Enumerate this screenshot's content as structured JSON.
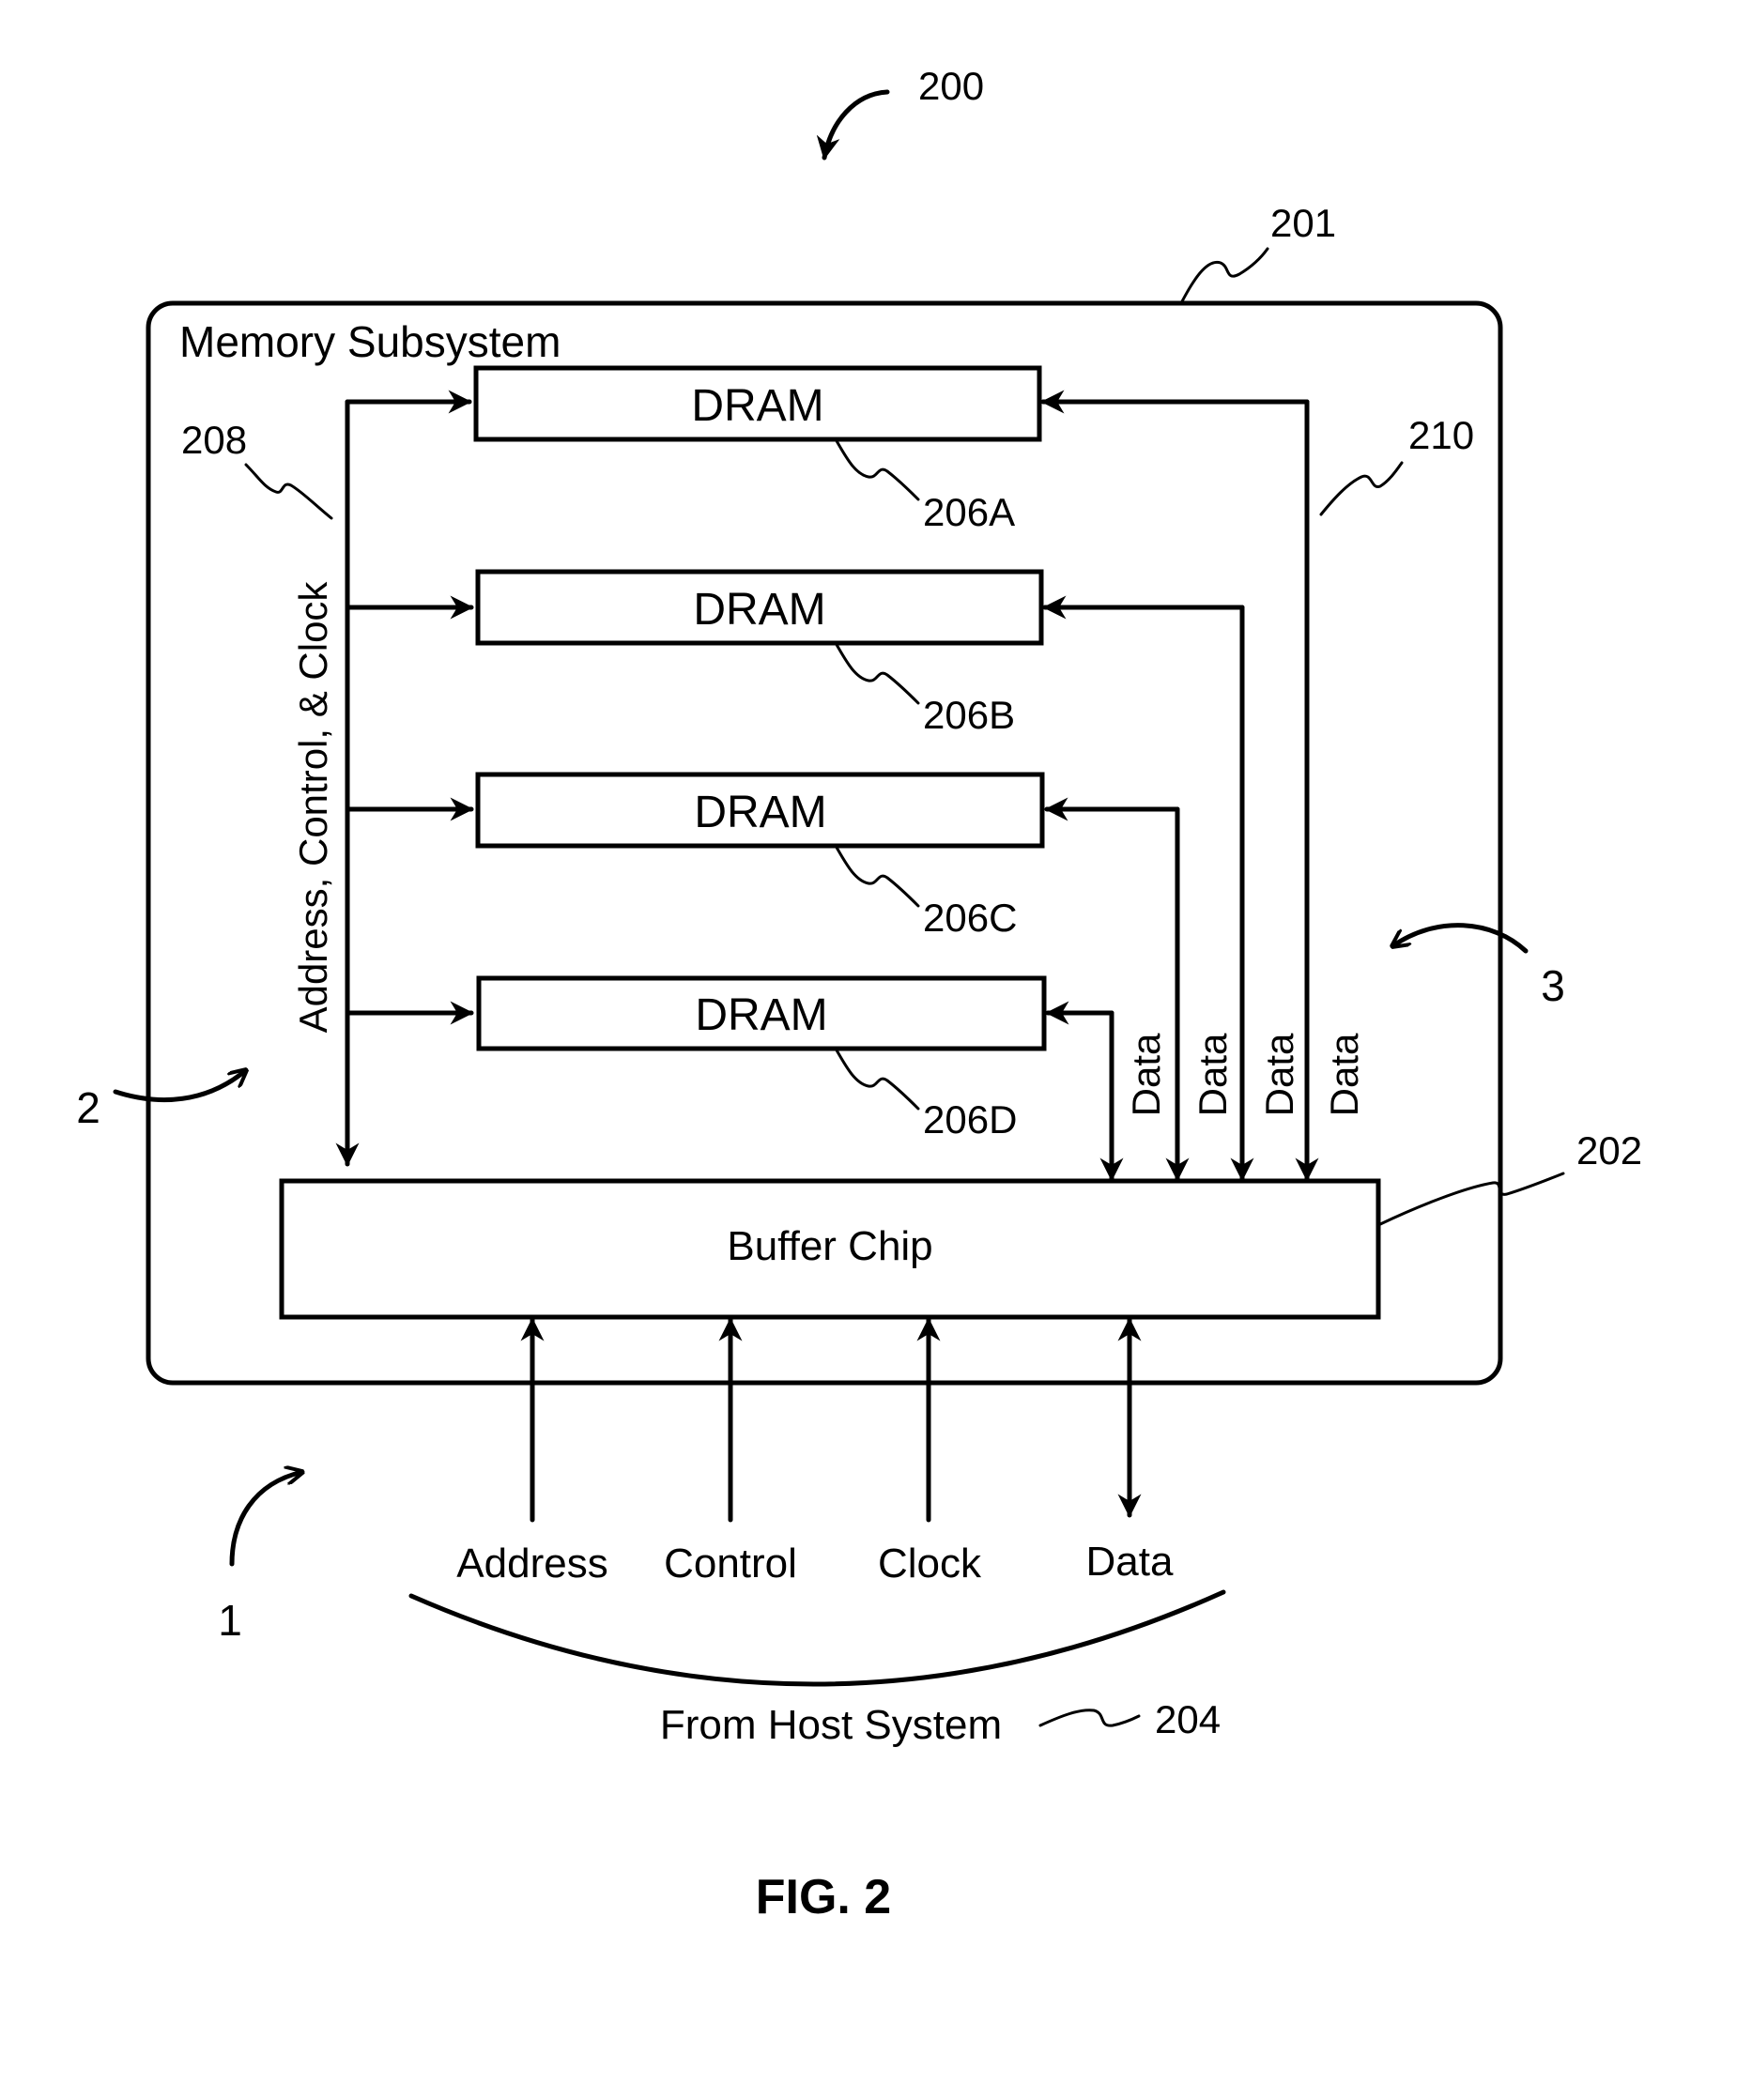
{
  "figure": {
    "ref_number": "200",
    "caption": "FIG. 2"
  },
  "memory_subsystem": {
    "title": "Memory Subsystem",
    "ref": "201"
  },
  "drams": [
    {
      "label": "DRAM",
      "ref": "206A"
    },
    {
      "label": "DRAM",
      "ref": "206B"
    },
    {
      "label": "DRAM",
      "ref": "206C"
    },
    {
      "label": "DRAM",
      "ref": "206D"
    }
  ],
  "buffer_chip": {
    "label": "Buffer Chip",
    "ref": "202"
  },
  "internal_buses": {
    "address_control_clock": {
      "label": "Address, Control, & Clock",
      "ref": "208"
    },
    "data": {
      "label": "Data",
      "ref": "210",
      "lines": [
        "Data",
        "Data",
        "Data",
        "Data"
      ]
    }
  },
  "host": {
    "signals": [
      "Address",
      "Control",
      "Clock",
      "Data"
    ],
    "label": "From Host System",
    "ref": "204"
  },
  "region_markers": [
    "1",
    "2",
    "3"
  ]
}
